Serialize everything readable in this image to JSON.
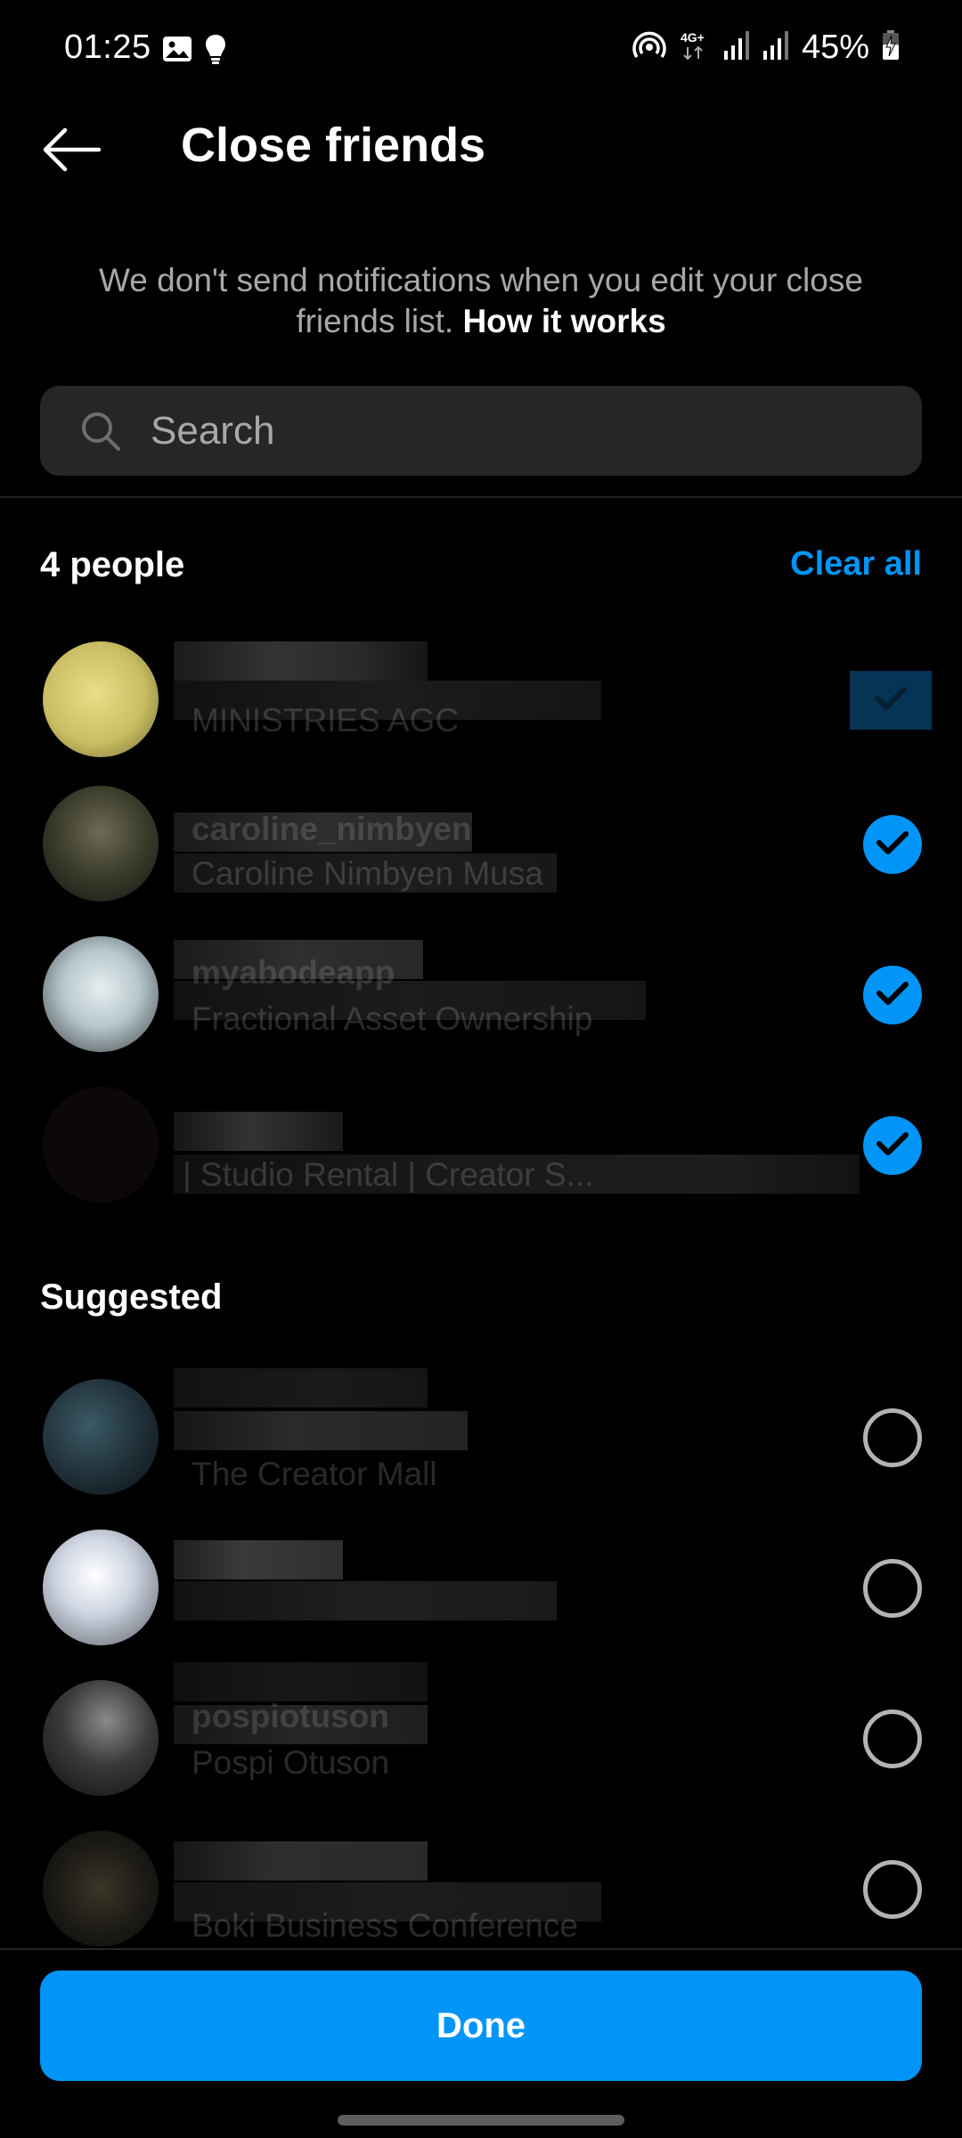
{
  "status_bar": {
    "time": "01:25",
    "left_icons": [
      "gallery-icon",
      "lightbulb-icon"
    ],
    "right_icons": [
      "hotspot-icon",
      "4g-plus-icon",
      "signal-icon",
      "signal-icon",
      "battery-charging-icon"
    ],
    "network_label": "4G+",
    "battery": "45%"
  },
  "header": {
    "back_icon": "arrow-left-icon",
    "title": "Close friends"
  },
  "info": {
    "text": "We don't send notifications when you edit your close friends list. ",
    "link": "How it works"
  },
  "search": {
    "placeholder": "Search",
    "value": ""
  },
  "selected_section": {
    "title": "4 people",
    "clear_all": "Clear all",
    "items": [
      {
        "username": "",
        "full_name": "MINISTRIES AGC",
        "selected": true
      },
      {
        "username": "caroline_nimbyen",
        "full_name": "Caroline Nimbyen Musa",
        "selected": true
      },
      {
        "username": "myabodeapp",
        "full_name": "Fractional Asset Ownership",
        "selected": true
      },
      {
        "username": "",
        "full_name": "| Studio Rental | Creator S...",
        "selected": true
      }
    ]
  },
  "suggested_section": {
    "title": "Suggested",
    "items": [
      {
        "username": "",
        "full_name": "The Creator Mall",
        "selected": false
      },
      {
        "username": "",
        "full_name": "",
        "selected": false
      },
      {
        "username": "pospiotuson",
        "full_name": "Pospi Otuson",
        "selected": false
      },
      {
        "username": "",
        "full_name": "Boki Business Conference",
        "selected": false
      }
    ]
  },
  "footer": {
    "done_label": "Done"
  },
  "colors": {
    "accent": "#0095f6",
    "background": "#000000",
    "search_bg": "#262626",
    "secondary_text": "#a8a8a8"
  }
}
